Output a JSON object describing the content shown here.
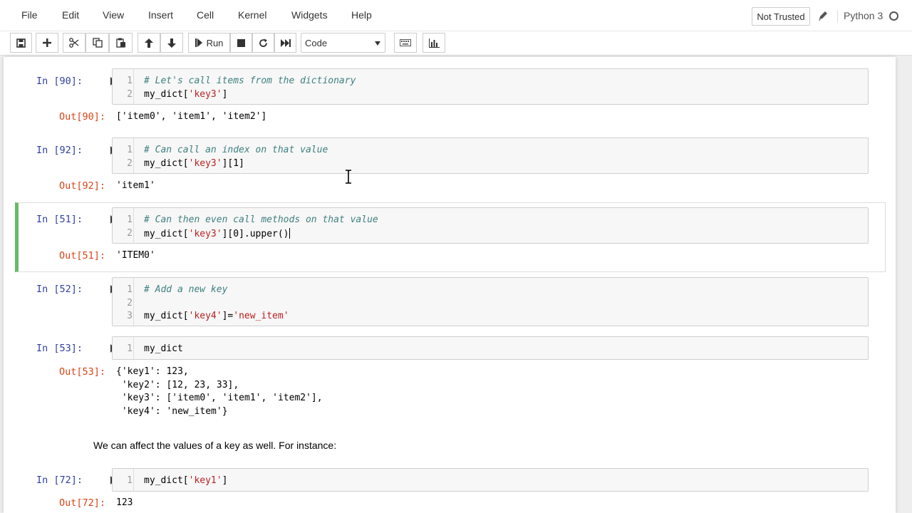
{
  "menu": {
    "items": [
      "File",
      "Edit",
      "View",
      "Insert",
      "Cell",
      "Kernel",
      "Widgets",
      "Help"
    ],
    "trust_status": "Not Trusted",
    "kernel_name": "Python 3"
  },
  "toolbar": {
    "run_label": "Run",
    "cell_type": "Code",
    "icons": [
      "save-icon",
      "plus-icon",
      "scissors-icon",
      "copy-icon",
      "paste-icon",
      "arrow-up-icon",
      "arrow-down-icon",
      "step-forward-icon",
      "stop-icon",
      "restart-icon",
      "fast-forward-icon",
      "keyboard-icon",
      "bar-chart-icon"
    ]
  },
  "cells": [
    {
      "in_prompt": "In [90]:",
      "lines": [
        {
          "num": "1",
          "kind": "comment",
          "text": "# Let's call items from the dictionary"
        },
        {
          "num": "2",
          "kind": "code",
          "pre": "my_dict[",
          "str": "'key3'",
          "post": "]"
        }
      ],
      "out_prompt": "Out[90]:",
      "output": "['item0', 'item1', 'item2']"
    },
    {
      "in_prompt": "In [92]:",
      "lines": [
        {
          "num": "1",
          "kind": "comment",
          "text": "# Can call an index on that value"
        },
        {
          "num": "2",
          "kind": "code",
          "pre": "my_dict[",
          "str": "'key3'",
          "post": "][1]"
        }
      ],
      "out_prompt": "Out[92]:",
      "output": "'item1'"
    },
    {
      "in_prompt": "In [51]:",
      "lines": [
        {
          "num": "1",
          "kind": "comment",
          "text": "# Can then even call methods on that value"
        },
        {
          "num": "2",
          "kind": "code",
          "pre": "my_dict[",
          "str": "'key3'",
          "post": "][0].upper()"
        }
      ],
      "out_prompt": "Out[51]:",
      "output": "'ITEM0'"
    },
    {
      "in_prompt": "In [52]:",
      "lines": [
        {
          "num": "1",
          "kind": "comment",
          "text": "# Add a new key"
        },
        {
          "num": "2",
          "kind": "code",
          "pre": "",
          "str": "",
          "post": ""
        },
        {
          "num": "3",
          "kind": "code",
          "pre": "my_dict[",
          "str": "'key4'",
          "post": "]=",
          "str2": "'new_item'"
        }
      ]
    },
    {
      "in_prompt": "In [53]:",
      "lines": [
        {
          "num": "1",
          "kind": "code",
          "pre": "my_dict",
          "str": "",
          "post": ""
        }
      ],
      "out_prompt": "Out[53]:",
      "output": "{'key1': 123,\n 'key2': [12, 23, 33],\n 'key3': ['item0', 'item1', 'item2'],\n 'key4': 'new_item'}"
    },
    {
      "markdown": "We can affect the values of a key as well. For instance:"
    },
    {
      "in_prompt": "In [72]:",
      "lines": [
        {
          "num": "1",
          "kind": "code",
          "pre": "my_dict[",
          "str": "'key1'",
          "post": "]"
        }
      ],
      "out_prompt": "Out[72]:",
      "output": "123"
    }
  ]
}
